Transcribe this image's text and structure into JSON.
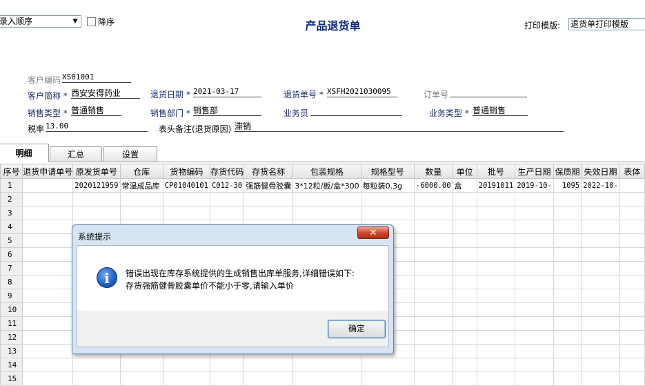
{
  "header": {
    "sort_value": "录入顺序",
    "desc_label": "降序",
    "title": "产品退货单",
    "print_label": "打印模版:",
    "print_value": "退货单打印模版"
  },
  "form": {
    "customer_code_label": "客户编码",
    "customer_code": "XS01001",
    "customer_short_label": "客户简称",
    "customer_short": "西安安得药业",
    "return_date_label": "退货日期",
    "return_date": "2021-03-17",
    "return_no_label": "退货单号",
    "return_no": "XSFH2021030095",
    "order_no_label": "订单号",
    "order_no": "",
    "sales_type_label": "销售类型",
    "sales_type": "普通销售",
    "sales_dept_label": "销售部门",
    "sales_dept": "销售部",
    "salesperson_label": "业务员",
    "salesperson": "",
    "biz_type_label": "业务类型",
    "biz_type": "普通销售",
    "tax_rate_label": "税率",
    "tax_rate": "13.00",
    "remark_label": "表头备注(退货原因)",
    "remark": "滞销"
  },
  "tabs": [
    {
      "label": "明细"
    },
    {
      "label": "汇总"
    },
    {
      "label": "设置"
    }
  ],
  "grid": {
    "headers": [
      "序号",
      "退货申请单号",
      "原发货单号",
      "仓库",
      "货物编码",
      "存货代码",
      "存货名称",
      "包装规格",
      "规格型号",
      "数量",
      "单位",
      "批号",
      "生产日期",
      "保质期",
      "失效日期",
      "表体"
    ],
    "row1": [
      "1",
      "",
      "2020121959",
      "常温成品库",
      "CP01040101",
      "C012-30",
      "强筋健骨胶囊",
      "3*12粒/板/盒*300",
      "每粒装0.3g",
      "-6000.00",
      "盒",
      "20191011",
      "2019-10-",
      "1095",
      "2022-10-",
      ""
    ],
    "row_numbers": [
      "2",
      "3",
      "4",
      "5",
      "6",
      "7",
      "8",
      "9",
      "10",
      "11",
      "12",
      "13",
      "14",
      "15"
    ]
  },
  "dialog": {
    "title": "系统提示",
    "close_glyph": "✕",
    "icon_glyph": "i",
    "line1": "错误出现在库存系统提供的生成销售出库单服务,详细错误如下:",
    "line2": "存货强筋健骨胶囊单价不能小于零,请输入单价",
    "ok_label": "确定"
  },
  "colors": {
    "title": "#0a2a7a",
    "label_navy": "#1c2e6f",
    "dialog_frame": "#d6e4f4",
    "close_red": "#c9432a"
  },
  "icons": {
    "dialog_icon": "info-icon",
    "close": "close-icon",
    "dropdown": "chevron-down-icon"
  }
}
